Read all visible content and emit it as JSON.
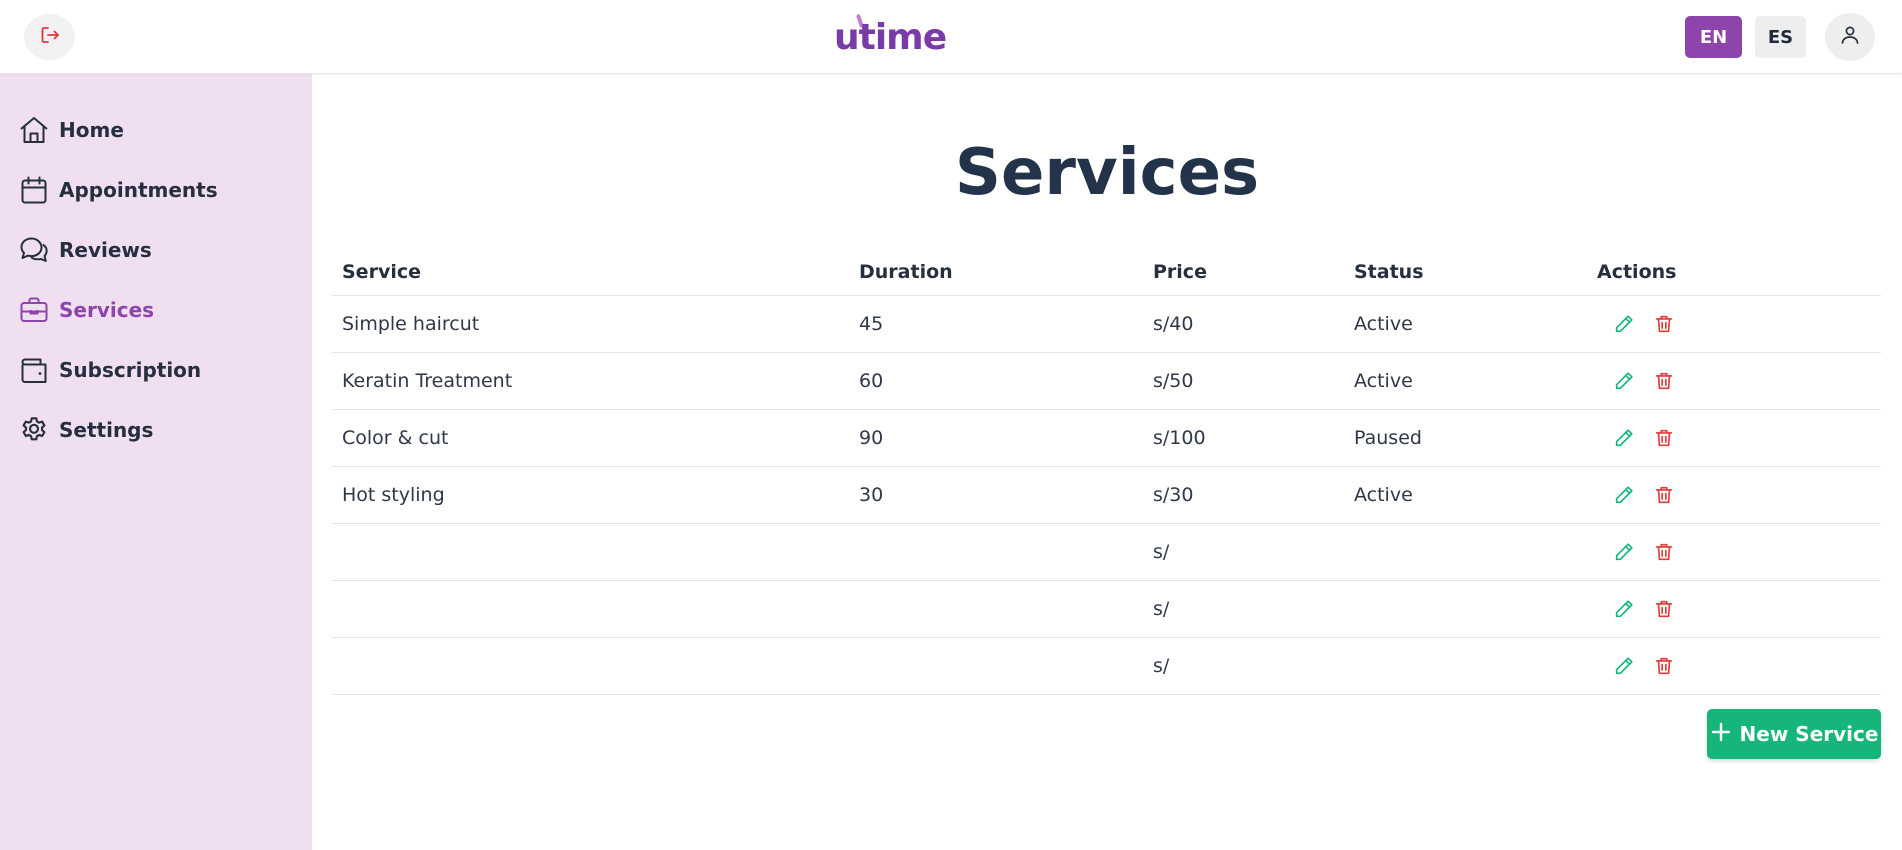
{
  "header": {
    "logo": "utime",
    "lang_en": "EN",
    "lang_es": "ES",
    "logout_icon": "logout-icon",
    "user_icon": "user-icon",
    "active_language": "EN"
  },
  "sidebar": {
    "items": [
      {
        "label": "Home",
        "icon": "home-icon",
        "active": false
      },
      {
        "label": "Appointments",
        "icon": "calendar-icon",
        "active": false
      },
      {
        "label": "Reviews",
        "icon": "chat-bubbles-icon",
        "active": false
      },
      {
        "label": "Services",
        "icon": "briefcase-icon",
        "active": true
      },
      {
        "label": "Subscription",
        "icon": "wallet-icon",
        "active": false
      },
      {
        "label": "Settings",
        "icon": "gear-icon",
        "active": false
      }
    ]
  },
  "main": {
    "title": "Services",
    "table": {
      "headers": [
        "Service",
        "Duration",
        "Price",
        "Status",
        "Actions"
      ],
      "rows": [
        {
          "service": "Simple haircut",
          "duration": "45",
          "price": "s/40",
          "status": "Active"
        },
        {
          "service": "Keratin Treatment",
          "duration": "60",
          "price": "s/50",
          "status": "Active"
        },
        {
          "service": "Color & cut",
          "duration": "90",
          "price": "s/100",
          "status": "Paused"
        },
        {
          "service": "Hot styling",
          "duration": "30",
          "price": "s/30",
          "status": "Active"
        },
        {
          "service": "",
          "duration": "",
          "price": "s/",
          "status": ""
        },
        {
          "service": "",
          "duration": "",
          "price": "s/",
          "status": ""
        },
        {
          "service": "",
          "duration": "",
          "price": "s/",
          "status": ""
        }
      ]
    },
    "new_service_label": "New Service"
  },
  "colors": {
    "brand_purple": "#8e44ad",
    "sidebar_bg": "#f0dff0",
    "edit_green": "#16b67a",
    "delete_red": "#e03a3a",
    "logout_red": "#e03a3a"
  }
}
